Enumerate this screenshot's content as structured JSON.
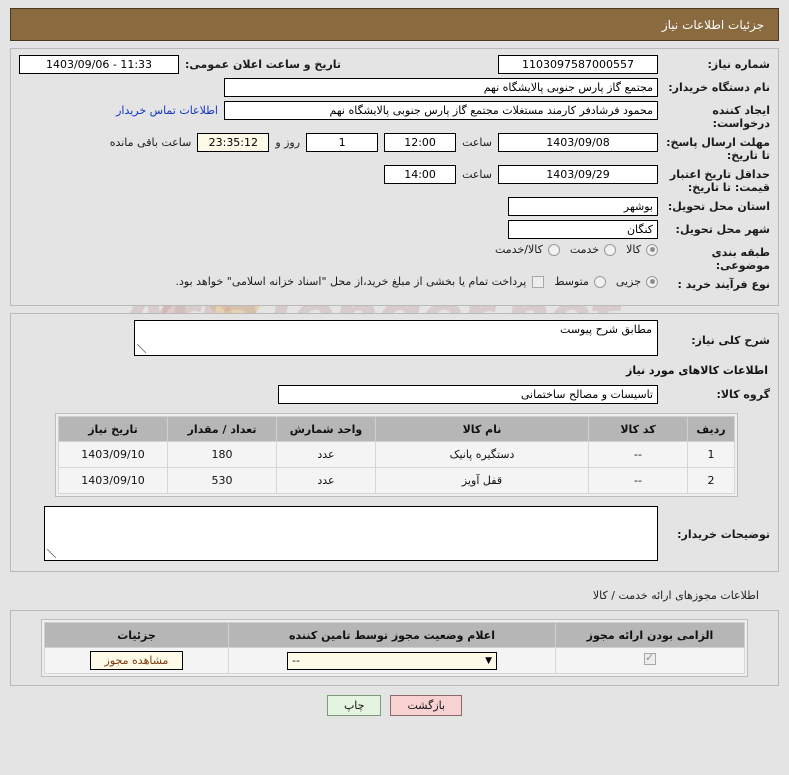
{
  "header": {
    "title": "جزئیات اطلاعات نیاز"
  },
  "watermark": {
    "text": "AriaTender.net"
  },
  "form": {
    "need_number_label": "شماره نیاز:",
    "need_number_value": "1103097587000557",
    "public_announce_label": "تاریخ و ساعت اعلان عمومی:",
    "public_announce_value": "11:33 - 1403/09/06",
    "buyer_org_label": "نام دستگاه خریدار:",
    "buyer_org_value": "مجتمع گاز پارس جنوبی  پالایشگاه نهم",
    "buyer_org_value2": "",
    "requester_label": "ایجاد کننده درخواست:",
    "requester_value": "محمود فرشادفر کارمند مستغلات  مجتمع گاز پارس جنوبی  پالایشگاه نهم",
    "contact_link": "اطلاعات تماس خریدار",
    "deadline_label": "مهلت ارسال پاسخ: تا تاریخ:",
    "deadline_date": "1403/09/08",
    "hour_label": "ساعت",
    "deadline_time": "12:00",
    "days_remaining": "1",
    "days_word": "روز و",
    "clock_remaining": "23:35:12",
    "remaining_word": "ساعت باقی مانده",
    "price_valid_label": "حداقل تاریخ اعتبار قیمت: تا تاریخ:",
    "price_valid_date": "1403/09/29",
    "price_valid_time": "14:00",
    "province_label": "استان محل تحویل:",
    "province_value": "بوشهر",
    "city_label": "شهر محل تحویل:",
    "city_value": "کنگان",
    "category_label": "طبقه بندی موضوعی:",
    "category_options": [
      {
        "label": "کالا",
        "selected": true
      },
      {
        "label": "خدمت",
        "selected": false
      },
      {
        "label": "کالا/خدمت",
        "selected": false
      }
    ],
    "process_label": "نوع فرآیند خرید :",
    "process_options": [
      {
        "label": "جزیی",
        "selected": true
      },
      {
        "label": "متوسط",
        "selected": false
      }
    ],
    "treasury_checked": false,
    "treasury_note": "پرداخت تمام یا بخشی از مبلغ خرید،از محل \"اسناد خزانه اسلامی\" خواهد بود."
  },
  "need_desc": {
    "label": "شرح کلی نیاز:",
    "value": "مطابق شرح پیوست"
  },
  "goods_section": {
    "heading": "اطلاعات کالاهای مورد نیاز",
    "group_label": "گروه کالا:",
    "group_value": "تاسیسات و مصالح ساختمانی",
    "columns": [
      "ردیف",
      "کد کالا",
      "نام کالا",
      "واحد شمارش",
      "تعداد / مقدار",
      "تاریخ نیاز"
    ],
    "rows": [
      {
        "row": "1",
        "code": "--",
        "name": "دستگیره پانیک",
        "unit": "عدد",
        "qty": "180",
        "date": "1403/09/10"
      },
      {
        "row": "2",
        "code": "--",
        "name": "قفل آویز",
        "unit": "عدد",
        "qty": "530",
        "date": "1403/09/10"
      }
    ]
  },
  "buyer_notes": {
    "label": "توضیحات خریدار:",
    "value": ""
  },
  "permits": {
    "heading": "اطلاعات مجوزهای ارائه خدمت / کالا",
    "columns": [
      "الزامی بودن ارائه مجوز",
      "اعلام وضعیت مجوز توسط تامین کننده",
      "جزئیات"
    ],
    "rows": [
      {
        "required": true,
        "status": "--",
        "details_button": "مشاهده مجوز"
      }
    ]
  },
  "footer": {
    "back_label": "بازگشت",
    "print_label": "چاپ"
  }
}
